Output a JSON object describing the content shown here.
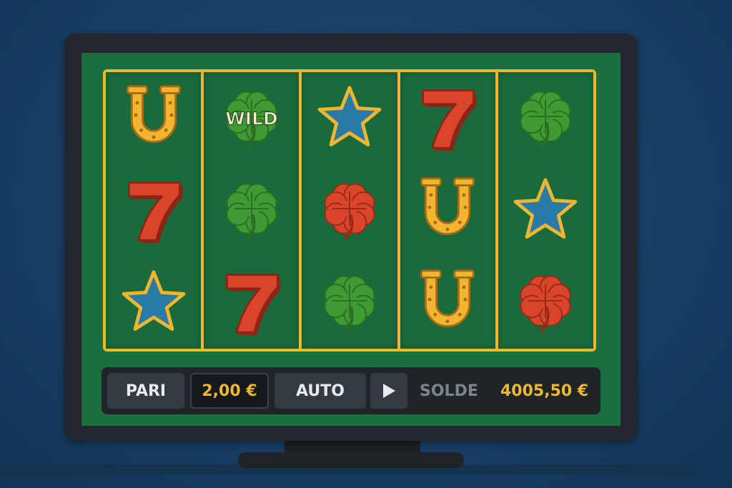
{
  "reels": [
    [
      "horseshoe",
      "seven",
      "star"
    ],
    [
      "wild-clover",
      "clover-green",
      "seven"
    ],
    [
      "star",
      "clover-red",
      "clover-green"
    ],
    [
      "seven",
      "horseshoe",
      "horseshoe"
    ],
    [
      "clover-green",
      "star",
      "clover-red"
    ]
  ],
  "wild": {
    "label": "WILD"
  },
  "controls": {
    "bet_label": "PARI",
    "bet_value": "2,00 €",
    "auto_label": "AUTO",
    "balance_label": "SOLDE",
    "balance_value": "4005,50 €"
  },
  "colors": {
    "gold": "#f0b632",
    "felt": "#1b6e3e",
    "seven": "#d8452b",
    "clover": "#3f9a34",
    "star": "#2a7aa6"
  },
  "icons": {
    "play": "play-icon"
  }
}
